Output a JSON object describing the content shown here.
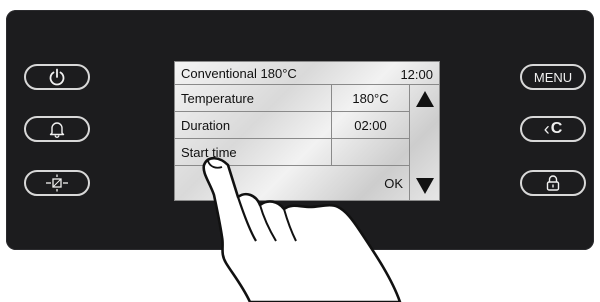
{
  "left_buttons": [
    {
      "name": "power-button",
      "icon": "power-icon"
    },
    {
      "name": "bell-button",
      "icon": "bell-icon"
    },
    {
      "name": "light-button",
      "icon": "light-icon"
    }
  ],
  "right_buttons": {
    "menu_label": "MENU",
    "back_label": "C",
    "lock_icon": "lock-icon"
  },
  "screen": {
    "title": "Conventional 180°C",
    "clock": "12:00",
    "rows": [
      {
        "label": "Temperature",
        "value": "180°C"
      },
      {
        "label": "Duration",
        "value": "02:00"
      },
      {
        "label": "Start time",
        "value": ""
      },
      {
        "label": "",
        "value": "OK"
      }
    ],
    "scroll_up_icon": "triangle-up-icon",
    "scroll_down_icon": "triangle-down-icon"
  },
  "colors": {
    "panel": "#1c1c1e",
    "button_outline": "#d8d8d8"
  }
}
